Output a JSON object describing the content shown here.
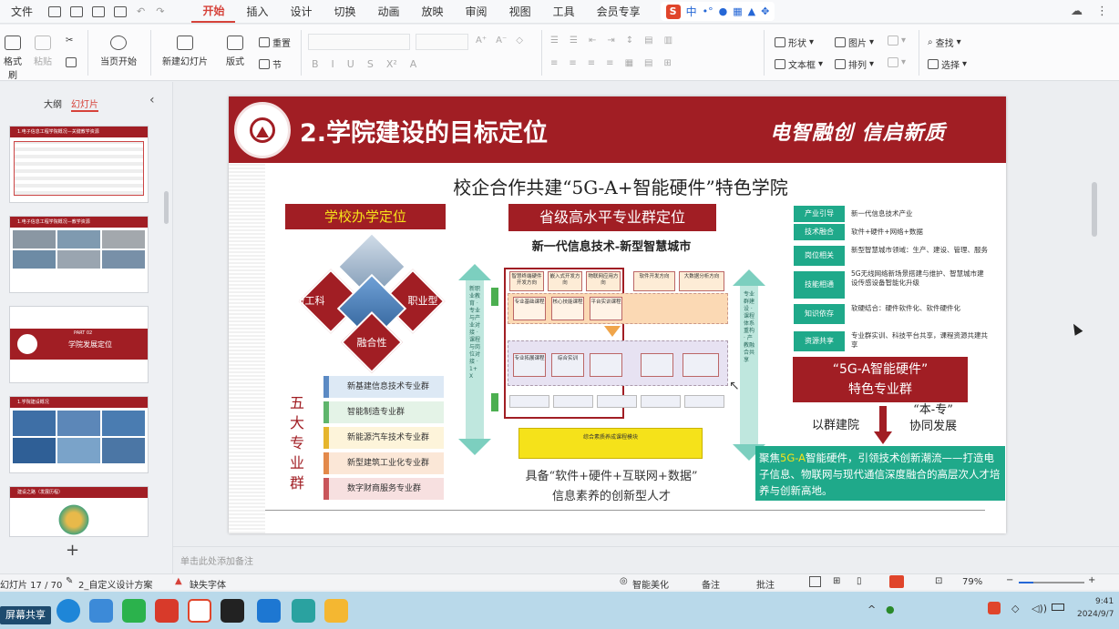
{
  "menubar": {
    "file_label": "文件",
    "tabs": [
      "开始",
      "插入",
      "设计",
      "切换",
      "动画",
      "放映",
      "审阅",
      "视图",
      "工具",
      "会员专享"
    ],
    "active_tab": "开始",
    "ime_text": "中"
  },
  "ribbon": {
    "format_painter": "格式刷",
    "paste": "粘贴",
    "from_current": "当页开始",
    "new_slide": "新建幻灯片",
    "layout": "版式",
    "reset": "重置",
    "section": "节",
    "shape": "形状",
    "picture": "图片",
    "textbox": "文本框",
    "arrange": "排列",
    "find": "查找",
    "select": "选择",
    "font_buttons": [
      "B",
      "I",
      "U",
      "S",
      "X²",
      "A"
    ]
  },
  "leftpanel": {
    "tab_outline": "大纲",
    "tab_slides": "幻灯片",
    "add_label": "+",
    "thumbs": [
      {
        "title": "1.电子信息工程学院概况—关键教学资源"
      },
      {
        "title": "1.电子信息工程学院概况—教学资源"
      },
      {
        "title": "学院发展定位",
        "part": "PART 02"
      },
      {
        "title": "1.学院建设概况"
      },
      {
        "title": "建设之路（发展历程）"
      }
    ]
  },
  "slide": {
    "title": "2.学院建设的目标定位",
    "slogan": "电智融创  信启新质",
    "main_heading": "校企合作共建“5G-A+智能硬件”特色学院",
    "school_box": "学校办学定位",
    "diamond_labels": [
      "新工科",
      "职业型",
      "融合性"
    ],
    "five_majors_title": "五大专业群",
    "majors": [
      "新基建信息技术专业群",
      "智能制造专业群",
      "新能源汽车技术专业群",
      "新型建筑工业化专业群",
      "数字财商服务专业群"
    ],
    "province_box": "省级高水平专业群定位",
    "subheading": "新一代信息技术-新型智慧城市",
    "left_arrow_text": "新职业教育 · 专业与产业对接 · 课程与岗位对接 · 1+X",
    "right_arrow_text": "专业群建设 · 课程体系重构 · 产教融合共享",
    "diagram_boxes": [
      "智慧终端硬件开发方向",
      "嵌入式开发方向",
      "物联网应用方向",
      "软件开发方向",
      "大数据分析方向",
      "专业基础课程",
      "核心技能课程",
      "平台实训课程",
      "专业拓展课程",
      "综合实训"
    ],
    "diagram_bottom": "综合素质养成课程模块",
    "qualification_line1": "具备“软件+硬件+互联网+数据”",
    "qualification_line2": "信息素养的创新型人才",
    "labels": [
      {
        "tag": "产业引导",
        "text": "新一代信息技术产业"
      },
      {
        "tag": "技术融合",
        "text": "软件+硬件+网络+数据"
      },
      {
        "tag": "岗位相关",
        "text": "新型智慧城市领域：生产、建设、管理、服务"
      },
      {
        "tag": "技能相通",
        "text": "5G无线网络新场景搭建与维护、智慧城市建设传感设备智能化升级"
      },
      {
        "tag": "知识依存",
        "text": "软硬结合：硬件软件化、软件硬件化"
      },
      {
        "tag": "资源共享",
        "text": "专业群实训、科技平台共享，课程资源共建共享"
      }
    ],
    "feature_line1": "“5G-A智能硬件”",
    "feature_line2": "特色专业群",
    "group_left": "以群建院",
    "group_right_line1": "“本-专”",
    "group_right_line2": "协同发展",
    "green_pre": "聚焦",
    "green_highlight": "5G-A",
    "green_post": "智能硬件，引领技术创新潮流——打造电子信息、物联网与现代通信深度融合的高层次人才培养与创新高地。",
    "colors": {
      "primary_red": "#a11e24",
      "teal": "#1fa98a",
      "highlight_yellow": "#f5e21a"
    }
  },
  "notes": {
    "placeholder": "单击此处添加备注"
  },
  "statusbar": {
    "slide_counter": "幻灯片 17 / 70",
    "template": "2_自定义设计方案",
    "missing_font": "缺失字体",
    "beautify": "智能美化",
    "notes": "备注",
    "comments": "批注",
    "zoom": "79%"
  },
  "taskbar": {
    "share": "屏幕共享",
    "time": "9:41",
    "date": "2024/9/7"
  }
}
